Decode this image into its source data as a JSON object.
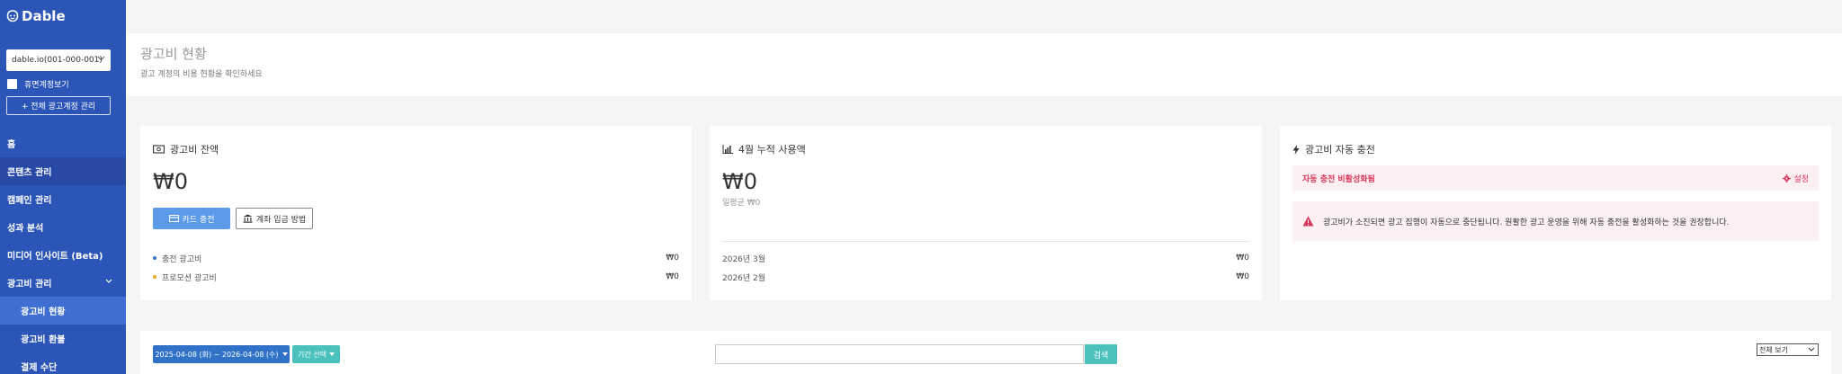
{
  "sidebar": {
    "logo_text": "Dable",
    "account_selector": "dable.io(001-000-001)",
    "dormant_label": "휴면계정보기",
    "manage_all_label": "+ 전체 광고계정 관리",
    "nav": {
      "home": "홈",
      "content": "콘텐츠 관리",
      "campaign": "캠페인 관리",
      "performance": "성과 분석",
      "media_insight": "미디어 인사이트 (Beta)",
      "ad_cost": "광고비 관리",
      "ad_cost_status": "광고비 현황",
      "ad_cost_refund": "광고비 환불",
      "payment_method": "결제 수단"
    }
  },
  "header": {
    "title": "광고비 현황",
    "subtitle": "광고 계정의 비용 현황을 확인하세요"
  },
  "balance_card": {
    "title": "광고비 잔액",
    "amount": "₩0",
    "card_charge_label": "카드 충전",
    "bank_deposit_label": "계좌 입금 방법",
    "rows": [
      {
        "label": "충전 광고비",
        "value": "₩0",
        "dot_color": "#3b6fd1"
      },
      {
        "label": "프로모션 광고비",
        "value": "₩0",
        "dot_color": "#f0a830"
      }
    ]
  },
  "usage_card": {
    "title": "4월 누적 사용액",
    "amount": "₩0",
    "avg_label": "일평균 ₩0",
    "rows": [
      {
        "label": "2026년 3월",
        "value": "₩0"
      },
      {
        "label": "2026년 2월",
        "value": "₩0"
      }
    ]
  },
  "auto_charge_card": {
    "title": "광고비 자동 충전",
    "status": "자동 충전 비활성화됨",
    "settings_label": "설정",
    "warning": "광고비가 소진되면 광고 집행이 자동으로 중단됩니다. 원활한 광고 운영을 위해 자동 충전을 활성화하는 것을 권장합니다."
  },
  "filter": {
    "date_range": "2025-04-08 (화) ~ 2026-04-08 (수)",
    "period_label": "기간 선택",
    "search_value": "",
    "search_button": "검색",
    "view_select": "전체 보기"
  },
  "colors": {
    "sidebar_bg": "#2c55b8",
    "sidebar_active_bg": "#3f6fd3",
    "primary_button": "#5b9be8",
    "teal": "#4bc1bd",
    "alert_pink": "#d9365c"
  }
}
